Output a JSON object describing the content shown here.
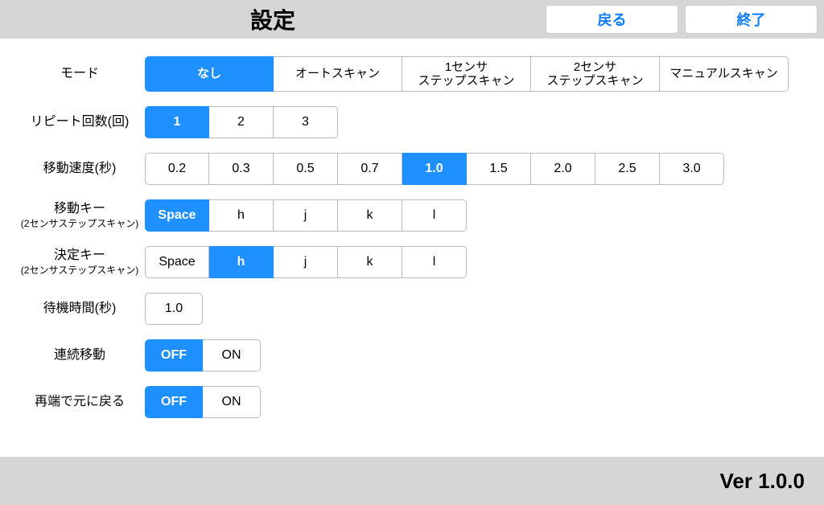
{
  "header": {
    "title": "設定",
    "back": "戻る",
    "exit": "終了"
  },
  "rows": {
    "mode": {
      "label": "モード",
      "options": [
        "なし",
        "オートスキャン",
        "1センサ\nステップスキャン",
        "2センサ\nステップスキャン",
        "マニュアルスキャン"
      ],
      "selected": 0
    },
    "repeat": {
      "label": "リピート回数(回)",
      "options": [
        "1",
        "2",
        "3"
      ],
      "selected": 0
    },
    "speed": {
      "label": "移動速度(秒)",
      "options": [
        "0.2",
        "0.3",
        "0.5",
        "0.7",
        "1.0",
        "1.5",
        "2.0",
        "2.5",
        "3.0"
      ],
      "selected": 4
    },
    "moveKey": {
      "label": "移動キー",
      "sub": "(2センサステップスキャン)",
      "options": [
        "Space",
        "h",
        "j",
        "k",
        "l"
      ],
      "selected": 0
    },
    "selectKey": {
      "label": "決定キー",
      "sub": "(2センサステップスキャン)",
      "options": [
        "Space",
        "h",
        "j",
        "k",
        "l"
      ],
      "selected": 1
    },
    "wait": {
      "label": "待機時間(秒)",
      "value": "1.0"
    },
    "continuous": {
      "label": "連続移動",
      "options": [
        "OFF",
        "ON"
      ],
      "selected": 0
    },
    "wrap": {
      "label": "再端で元に戻る",
      "options": [
        "OFF",
        "ON"
      ],
      "selected": 0
    }
  },
  "footer": {
    "version": "Ver 1.0.0"
  }
}
